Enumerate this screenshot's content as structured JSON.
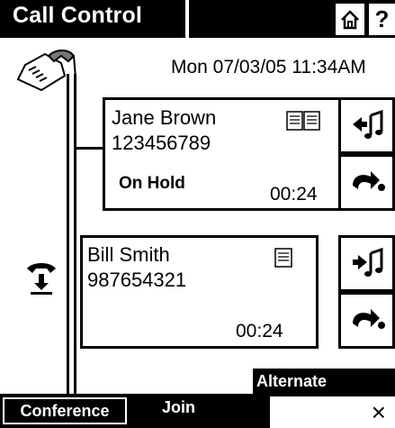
{
  "header": {
    "title": "Call Control",
    "home_icon": "home-icon",
    "help_label": "?"
  },
  "datetime": "Mon 07/03/05 11:34AM",
  "calls": [
    {
      "name": "Jane Brown",
      "number": "123456789",
      "status": "On Hold",
      "timer": "00:24",
      "contact_icon": "open-book-icon",
      "actions": [
        "retrieve-music-icon",
        "call-forward-icon"
      ]
    },
    {
      "name": "Bill Smith",
      "number": "987654321",
      "status": "",
      "timer": "00:24",
      "contact_icon": "book-icon",
      "actions": [
        "hold-music-icon",
        "call-forward-icon"
      ]
    }
  ],
  "softkeys": {
    "alternate": "Alternate",
    "conference": "Conference",
    "join": "Join",
    "close": "×"
  }
}
